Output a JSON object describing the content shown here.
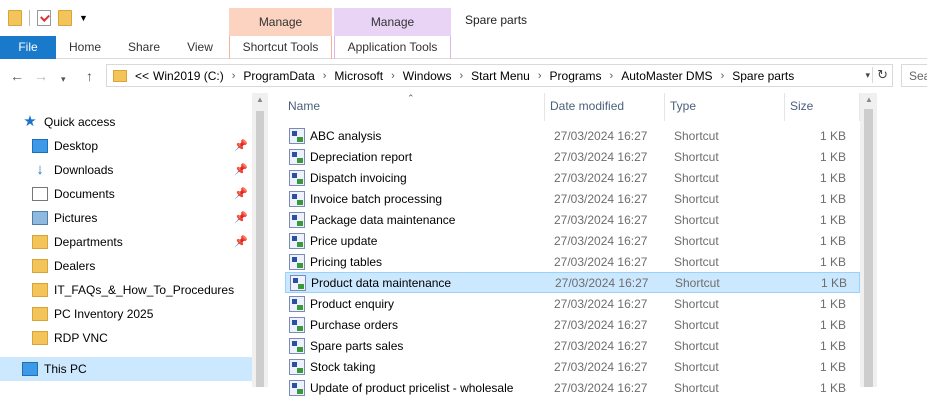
{
  "window": {
    "title": "Spare parts",
    "context_groups": [
      "Manage",
      "Manage"
    ]
  },
  "ribbon": {
    "tabs": [
      "File",
      "Home",
      "Share",
      "View",
      "Shortcut Tools",
      "Application Tools"
    ]
  },
  "address": {
    "prefix": "<<",
    "crumbs": [
      "Win2019 (C:)",
      "ProgramData",
      "Microsoft",
      "Windows",
      "Start Menu",
      "Programs",
      "AutoMaster DMS",
      "Spare parts"
    ],
    "search_placeholder": "Sea"
  },
  "nav": {
    "items": [
      {
        "label": "Quick access",
        "icon": "star-icon"
      },
      {
        "label": "Desktop",
        "icon": "desktop-icon",
        "pinned": true
      },
      {
        "label": "Downloads",
        "icon": "download-icon",
        "pinned": true
      },
      {
        "label": "Documents",
        "icon": "document-icon",
        "pinned": true
      },
      {
        "label": "Pictures",
        "icon": "pictures-icon",
        "pinned": true
      },
      {
        "label": "Departments",
        "icon": "folder-icon",
        "pinned": true
      },
      {
        "label": "Dealers",
        "icon": "folder-icon"
      },
      {
        "label": "IT_FAQs_&_How_To_Procedures",
        "icon": "folder-icon"
      },
      {
        "label": "PC Inventory 2025",
        "icon": "folder-icon"
      },
      {
        "label": "RDP VNC",
        "icon": "folder-icon"
      },
      {
        "label": "This PC",
        "icon": "computer-icon",
        "selected": true
      }
    ]
  },
  "columns": {
    "name": "Name",
    "date": "Date modified",
    "type": "Type",
    "size": "Size"
  },
  "files": [
    {
      "name": "ABC analysis",
      "date": "27/03/2024 16:27",
      "type": "Shortcut",
      "size": "1 KB"
    },
    {
      "name": "Depreciation report",
      "date": "27/03/2024 16:27",
      "type": "Shortcut",
      "size": "1 KB"
    },
    {
      "name": "Dispatch invoicing",
      "date": "27/03/2024 16:27",
      "type": "Shortcut",
      "size": "1 KB"
    },
    {
      "name": "Invoice batch processing",
      "date": "27/03/2024 16:27",
      "type": "Shortcut",
      "size": "1 KB"
    },
    {
      "name": "Package data maintenance",
      "date": "27/03/2024 16:27",
      "type": "Shortcut",
      "size": "1 KB"
    },
    {
      "name": "Price update",
      "date": "27/03/2024 16:27",
      "type": "Shortcut",
      "size": "1 KB"
    },
    {
      "name": "Pricing tables",
      "date": "27/03/2024 16:27",
      "type": "Shortcut",
      "size": "1 KB"
    },
    {
      "name": "Product data maintenance",
      "date": "27/03/2024 16:27",
      "type": "Shortcut",
      "size": "1 KB",
      "selected": true
    },
    {
      "name": "Product enquiry",
      "date": "27/03/2024 16:27",
      "type": "Shortcut",
      "size": "1 KB"
    },
    {
      "name": "Purchase orders",
      "date": "27/03/2024 16:27",
      "type": "Shortcut",
      "size": "1 KB"
    },
    {
      "name": "Spare parts sales",
      "date": "27/03/2024 16:27",
      "type": "Shortcut",
      "size": "1 KB"
    },
    {
      "name": "Stock taking",
      "date": "27/03/2024 16:27",
      "type": "Shortcut",
      "size": "1 KB"
    },
    {
      "name": "Update of product pricelist - wholesale",
      "date": "27/03/2024 16:27",
      "type": "Shortcut",
      "size": "1 KB"
    }
  ],
  "colors": {
    "file_tab": "#1979ca",
    "selection": "#cce8ff",
    "manage_shortcut": "#fbd3c0",
    "manage_app": "#e9d4f5"
  }
}
